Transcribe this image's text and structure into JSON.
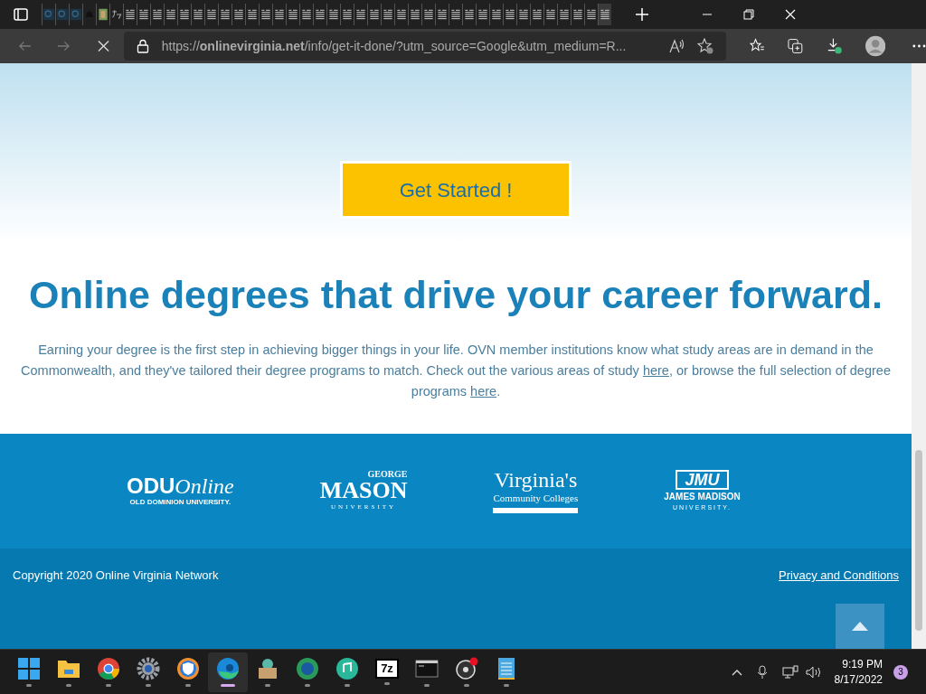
{
  "tabs": [
    {
      "kind": "search",
      "selected": false
    },
    {
      "kind": "search",
      "selected": false
    },
    {
      "kind": "search",
      "selected": false
    },
    {
      "kind": "bell",
      "selected": false
    },
    {
      "kind": "photo",
      "selected": false
    },
    {
      "kind": "translate",
      "selected": false
    },
    {
      "kind": "doc",
      "selected": false
    },
    {
      "kind": "doc",
      "selected": false
    },
    {
      "kind": "doc",
      "selected": false
    },
    {
      "kind": "doc",
      "selected": false
    },
    {
      "kind": "doc",
      "selected": false
    },
    {
      "kind": "doc",
      "selected": false
    },
    {
      "kind": "doc",
      "selected": false
    },
    {
      "kind": "doc",
      "selected": false
    },
    {
      "kind": "doc",
      "selected": false
    },
    {
      "kind": "doc",
      "selected": false
    },
    {
      "kind": "doc",
      "selected": false
    },
    {
      "kind": "doc",
      "selected": false
    },
    {
      "kind": "doc",
      "selected": false
    },
    {
      "kind": "doc",
      "selected": false
    },
    {
      "kind": "doc",
      "selected": false
    },
    {
      "kind": "doc",
      "selected": false
    },
    {
      "kind": "doc",
      "selected": false
    },
    {
      "kind": "doc",
      "selected": false
    },
    {
      "kind": "doc",
      "selected": false
    },
    {
      "kind": "doc",
      "selected": false
    },
    {
      "kind": "doc",
      "selected": false
    },
    {
      "kind": "doc",
      "selected": false
    },
    {
      "kind": "doc",
      "selected": false
    },
    {
      "kind": "doc",
      "selected": false
    },
    {
      "kind": "doc",
      "selected": false
    },
    {
      "kind": "doc",
      "selected": false
    },
    {
      "kind": "doc",
      "selected": false
    },
    {
      "kind": "doc",
      "selected": false
    },
    {
      "kind": "doc",
      "selected": false
    },
    {
      "kind": "doc",
      "selected": false
    },
    {
      "kind": "doc",
      "selected": false
    },
    {
      "kind": "doc",
      "selected": false
    },
    {
      "kind": "doc",
      "selected": false
    },
    {
      "kind": "doc",
      "selected": false
    },
    {
      "kind": "doc",
      "selected": false
    },
    {
      "kind": "doc",
      "selected": true
    }
  ],
  "address_bar": {
    "url": "https://**onlinevirginia.net**/info/get-it-done/?utm_source=Google&utm_medium=R..."
  },
  "page": {
    "cta_button": "Get Started !",
    "heading": "Online degrees that drive your career forward.",
    "intro": [
      {
        "kind": "text",
        "text": "Earning your degree is the first step in achieving bigger things in your life. OVN member institutions know what study areas are in demand in the Commonwealth, and they've tailored their degree programs to match. Check out the various areas of study "
      },
      {
        "kind": "link",
        "text": "here"
      },
      {
        "kind": "text",
        "text": ", or browse the full selection of degree programs "
      },
      {
        "kind": "link",
        "text": "here"
      },
      {
        "kind": "text",
        "text": "."
      }
    ],
    "logos": [
      {
        "kind": "odu",
        "lines": [
          "ODUOnline",
          "OLD DOMINION UNIVERSITY."
        ]
      },
      {
        "kind": "mason",
        "lines": [
          "GEORGE",
          "MASON",
          "UNIVERSITY"
        ]
      },
      {
        "kind": "vccs",
        "lines": [
          "Virginia's",
          "Community Colleges"
        ]
      },
      {
        "kind": "jmu",
        "lines": [
          "JMU",
          "JAMES MADISON",
          "UNIVERSITY."
        ]
      }
    ],
    "copyright": "Copyright 2020 Online Virginia Network",
    "privacy_link": "Privacy and Conditions"
  },
  "taskbar": {
    "apps": [
      {
        "kind": "start",
        "selected": false
      },
      {
        "kind": "folder",
        "selected": false
      },
      {
        "kind": "chrome",
        "selected": false
      },
      {
        "kind": "settings",
        "selected": false
      },
      {
        "kind": "shield",
        "selected": false
      },
      {
        "kind": "edge",
        "selected": true
      },
      {
        "kind": "box",
        "selected": false
      },
      {
        "kind": "edge-beta",
        "selected": false
      },
      {
        "kind": "music",
        "selected": false
      },
      {
        "kind": "archive",
        "selected": false
      },
      {
        "kind": "terminal",
        "selected": false
      },
      {
        "kind": "record",
        "selected": false
      },
      {
        "kind": "notepad",
        "selected": false
      }
    ],
    "archive_label": "7z",
    "time": "9:19 PM",
    "date": "8/17/2022",
    "notification_count": "3"
  }
}
